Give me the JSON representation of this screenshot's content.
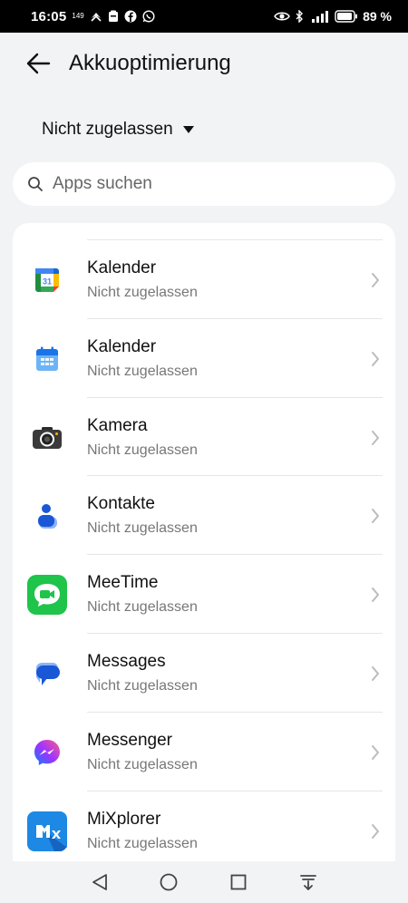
{
  "status_bar": {
    "time": "16:05",
    "small_indicator": "149",
    "battery_percent": "89 %",
    "left_icons": [
      "data-speed-icon",
      "notification-icon",
      "wallet-icon",
      "facebook-icon",
      "whatsapp-icon"
    ],
    "right_icons": [
      "eye-icon",
      "bluetooth-icon",
      "signal-icon",
      "battery-icon"
    ]
  },
  "header": {
    "title": "Akkuoptimierung"
  },
  "filter": {
    "selected": "Nicht zugelassen"
  },
  "search": {
    "placeholder": "Apps suchen"
  },
  "apps": [
    {
      "name": "Kalender",
      "status": "Nicht zugelassen",
      "icon": "google-calendar-icon"
    },
    {
      "name": "Kalender",
      "status": "Nicht zugelassen",
      "icon": "calendar-icon"
    },
    {
      "name": "Kamera",
      "status": "Nicht zugelassen",
      "icon": "camera-icon"
    },
    {
      "name": "Kontakte",
      "status": "Nicht zugelassen",
      "icon": "contacts-icon"
    },
    {
      "name": "MeeTime",
      "status": "Nicht zugelassen",
      "icon": "meetime-icon"
    },
    {
      "name": "Messages",
      "status": "Nicht zugelassen",
      "icon": "messages-icon"
    },
    {
      "name": "Messenger",
      "status": "Nicht zugelassen",
      "icon": "messenger-icon"
    },
    {
      "name": "MiXplorer",
      "status": "Nicht zugelassen",
      "icon": "mixplorer-icon"
    }
  ],
  "calendar_icon_day": "31",
  "navbar": [
    "back-nav-icon",
    "home-nav-icon",
    "recents-nav-icon",
    "notification-shade-icon"
  ]
}
